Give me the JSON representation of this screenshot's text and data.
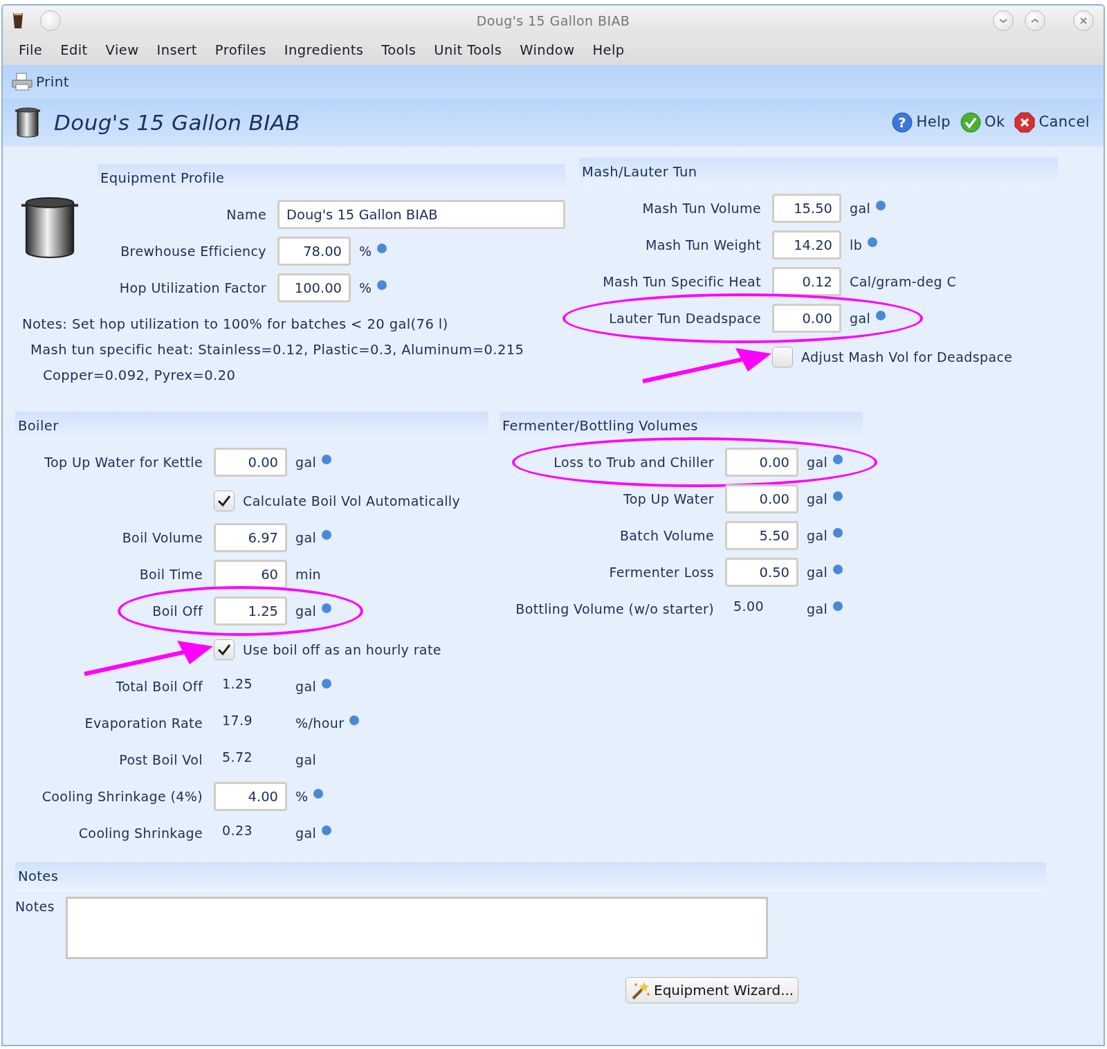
{
  "window": {
    "title": "Doug's 15 Gallon BIAB"
  },
  "menu": [
    "File",
    "Edit",
    "View",
    "Insert",
    "Profiles",
    "Ingredients",
    "Tools",
    "Unit Tools",
    "Window",
    "Help"
  ],
  "toolbar": [
    {
      "label": "Print"
    }
  ],
  "header": {
    "title": "Doug's 15 Gallon BIAB",
    "buttons": [
      {
        "kind": "help",
        "icon": "?",
        "label": "Help"
      },
      {
        "kind": "ok",
        "label": "Ok"
      },
      {
        "kind": "cancel",
        "label": "Cancel"
      }
    ]
  },
  "equipment_profile": {
    "heading": "Equipment Profile",
    "fields": [
      {
        "kind": "text",
        "label": "Name",
        "value": "Doug's 15 Gallon BIAB"
      },
      {
        "kind": "number",
        "label": "Brewhouse Efficiency",
        "value": "78.00",
        "unit": "%",
        "dot": true,
        "circled": false
      },
      {
        "kind": "number",
        "label": "Hop Utilization Factor",
        "value": "100.00",
        "unit": "%",
        "dot": true,
        "circled": false
      }
    ],
    "notes": [
      "Notes: Set hop utilization to 100% for batches < 20 gal(76 l)",
      "Mash tun specific heat: Stainless=0.12, Plastic=0.3, Aluminum=0.215",
      "Copper=0.092, Pyrex=0.20"
    ]
  },
  "mash_lauter_tun": {
    "heading": "Mash/Lauter Tun",
    "fields": [
      {
        "kind": "number",
        "label": "Mash Tun Volume",
        "value": "15.50",
        "unit": "gal",
        "dot": true,
        "circled": false
      },
      {
        "kind": "number",
        "label": "Mash Tun Weight",
        "value": "14.20",
        "unit": "lb",
        "dot": true,
        "circled": false
      },
      {
        "kind": "number",
        "label": "Mash Tun Specific Heat",
        "value": "0.12",
        "unit": "Cal/gram-deg C",
        "dot": false,
        "circled": false
      },
      {
        "kind": "number",
        "label": "Lauter Tun Deadspace",
        "value": "0.00",
        "unit": "gal",
        "dot": true,
        "circled": true
      },
      {
        "kind": "checkbox",
        "label": "Adjust Mash Vol for Deadspace",
        "checked": false,
        "pointed": true
      }
    ]
  },
  "boiler": {
    "heading": "Boiler",
    "fields": [
      {
        "kind": "number",
        "label": "Top Up Water for Kettle",
        "value": "0.00",
        "unit": "gal",
        "dot": true,
        "circled": false
      },
      {
        "kind": "checkbox",
        "label": "Calculate Boil Vol Automatically",
        "checked": true,
        "pointed": false
      },
      {
        "kind": "number",
        "label": "Boil Volume",
        "value": "6.97",
        "unit": "gal",
        "dot": true,
        "circled": false
      },
      {
        "kind": "number",
        "label": "Boil Time",
        "value": "60",
        "unit": "min",
        "dot": false,
        "circled": false
      },
      {
        "kind": "number",
        "label": "Boil Off",
        "value": "1.25",
        "unit": "gal",
        "dot": true,
        "circled": true
      },
      {
        "kind": "checkbox",
        "label": "Use boil off as an hourly rate",
        "checked": true,
        "pointed": true
      },
      {
        "kind": "readout",
        "label": "Total Boil Off",
        "value": "1.25",
        "unit": "gal",
        "dot": true,
        "circled": false
      },
      {
        "kind": "readout",
        "label": "Evaporation Rate",
        "value": "17.9",
        "unit": "%/hour",
        "dot": true,
        "circled": false
      },
      {
        "kind": "readout",
        "label": "Post Boil Vol",
        "value": "5.72",
        "unit": "gal",
        "dot": false,
        "circled": false
      },
      {
        "kind": "number",
        "label": "Cooling Shrinkage (4%)",
        "value": "4.00",
        "unit": "%",
        "dot": true,
        "circled": false
      },
      {
        "kind": "readout",
        "label": "Cooling Shrinkage",
        "value": "0.23",
        "unit": "gal",
        "dot": true,
        "circled": false
      }
    ]
  },
  "fermenter_bottling": {
    "heading": "Fermenter/Bottling Volumes",
    "fields": [
      {
        "kind": "number",
        "label": "Loss to Trub and Chiller",
        "value": "0.00",
        "unit": "gal",
        "dot": true,
        "circled": true
      },
      {
        "kind": "number",
        "label": "Top Up Water",
        "value": "0.00",
        "unit": "gal",
        "dot": true,
        "circled": false
      },
      {
        "kind": "number",
        "label": "Batch Volume",
        "value": "5.50",
        "unit": "gal",
        "dot": true,
        "circled": false
      },
      {
        "kind": "number",
        "label": "Fermenter Loss",
        "value": "0.50",
        "unit": "gal",
        "dot": true,
        "circled": false
      },
      {
        "kind": "readout",
        "label": "Bottling Volume (w/o starter)",
        "value": "5.00",
        "unit": "gal",
        "dot": true,
        "circled": false
      }
    ]
  },
  "notes": {
    "heading": "Notes",
    "label": "Notes"
  },
  "wizard_button": {
    "label": "Equipment Wizard..."
  }
}
